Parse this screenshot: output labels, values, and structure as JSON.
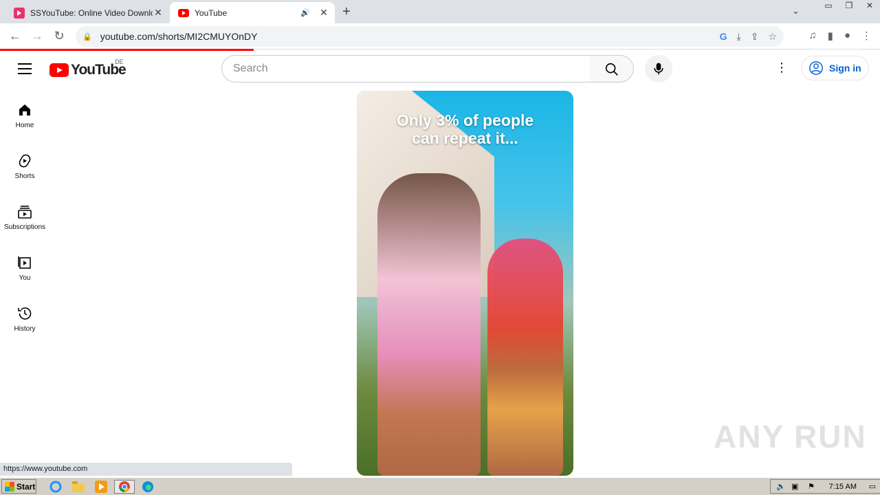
{
  "browser": {
    "tabs": [
      {
        "title": "SSYouTube: Online Video Downloader",
        "favicon": "ssyoutube-icon",
        "active": false
      },
      {
        "title": "YouTube",
        "favicon": "youtube-icon",
        "active": true,
        "audio": true
      }
    ],
    "url": "youtube.com/shorts/MI2CMUYOnDY",
    "status_url": "https://www.youtube.com"
  },
  "header": {
    "logo_text": "YouTube",
    "country": "DE",
    "search_placeholder": "Search",
    "sign_in": "Sign in"
  },
  "sidebar": {
    "items": [
      {
        "label": "Home",
        "icon": "home-icon"
      },
      {
        "label": "Shorts",
        "icon": "shorts-icon"
      },
      {
        "label": "Subscriptions",
        "icon": "subscriptions-icon"
      },
      {
        "label": "You",
        "icon": "you-icon"
      },
      {
        "label": "History",
        "icon": "history-icon"
      }
    ]
  },
  "video": {
    "caption_line1": "Only 3% of people",
    "caption_line2": "can repeat it..."
  },
  "taskbar": {
    "start_label": "Start",
    "clock": "7:15 AM"
  },
  "watermark": "ANY RUN",
  "colors": {
    "yt_red": "#ff0000",
    "link_blue": "#065fd4",
    "tab_strip": "#dee1e6",
    "taskbar": "#d4d0c8"
  }
}
